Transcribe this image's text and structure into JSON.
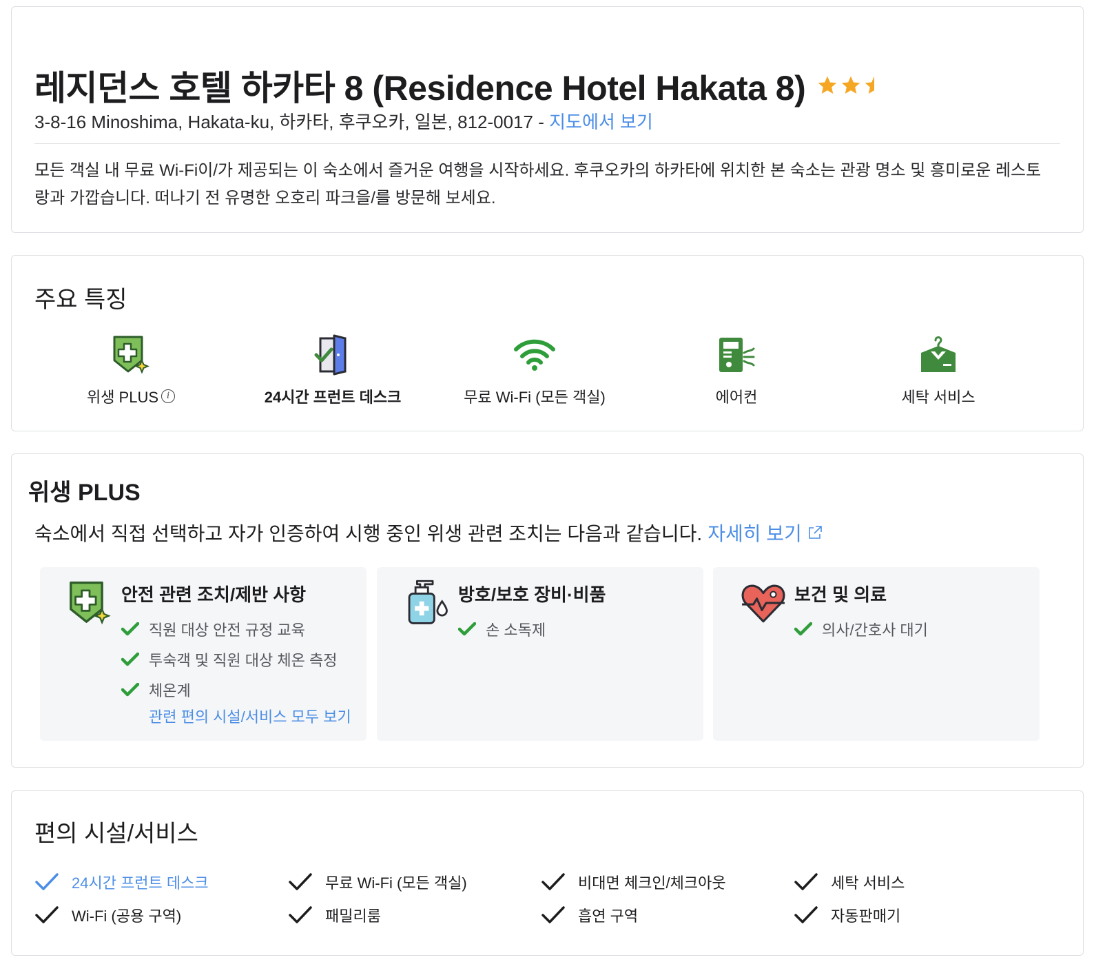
{
  "header": {
    "title": "레지던스 호텔 하카타 8 (Residence Hotel Hakata 8)",
    "star_rating": 2.5,
    "address": "3-8-16 Minoshima, Hakata-ku, 하카타, 후쿠오카, 일본, 812-0017 -",
    "map_link": "지도에서 보기",
    "description": "모든 객실 내 무료 Wi-Fi이/가 제공되는 이 숙소에서 즐거운 여행을 시작하세요. 후쿠오카의 하카타에 위치한 본 숙소는 관광 명소 및 흥미로운 레스토랑과 가깝습니다. 떠나기 전 유명한 오호리 파크을/를 방문해 보세요."
  },
  "features": {
    "title": "주요 특징",
    "items": [
      {
        "label": "위생 PLUS",
        "icon": "hygiene-shield-icon"
      },
      {
        "label": "24시간 프런트 데스크",
        "icon": "front-desk-door-icon"
      },
      {
        "label": "무료 Wi-Fi (모든 객실)",
        "icon": "wifi-icon"
      },
      {
        "label": "에어컨",
        "icon": "air-conditioner-icon"
      },
      {
        "label": "세탁 서비스",
        "icon": "laundry-hanger-icon"
      }
    ]
  },
  "hygiene": {
    "title": "위생 PLUS",
    "subtitle": "숙소에서 직접 선택하고 자가 인증하여 시행 중인 위생 관련 조치는 다음과 같습니다.",
    "more_link": "자세히 보기",
    "panels": [
      {
        "title": "안전 관련 조치/제반 사항",
        "icon": "hygiene-shield-icon",
        "items": [
          "직원 대상 안전 규정 교육",
          "투숙객 및 직원 대상 체온 측정",
          "체온계"
        ],
        "more": "관련 편의 시설/서비스 모두 보기"
      },
      {
        "title": "방호/보호 장비·비품",
        "icon": "sanitizer-bottle-icon",
        "items": [
          "손 소독제"
        ]
      },
      {
        "title": "보건 및 의료",
        "icon": "heart-pulse-icon",
        "items": [
          "의사/간호사 대기"
        ]
      }
    ]
  },
  "facilities": {
    "title": "편의 시설/서비스",
    "items": [
      {
        "label": "24시간 프런트 데스크",
        "highlighted": true
      },
      {
        "label": "무료 Wi-Fi (모든 객실)",
        "highlighted": false
      },
      {
        "label": "비대면 체크인/체크아웃",
        "highlighted": false
      },
      {
        "label": "세탁 서비스",
        "highlighted": false
      },
      {
        "label": "Wi-Fi (공용 구역)",
        "highlighted": false
      },
      {
        "label": "패밀리룸",
        "highlighted": false
      },
      {
        "label": "흡연 구역",
        "highlighted": false
      },
      {
        "label": "자동판매기",
        "highlighted": false
      }
    ]
  },
  "colors": {
    "accent": "#4c8ee6",
    "star": "#f5a623",
    "check_green": "#2e9e3a",
    "icon_green": "#3f8a3c",
    "panel_bg": "#f5f6f8"
  }
}
